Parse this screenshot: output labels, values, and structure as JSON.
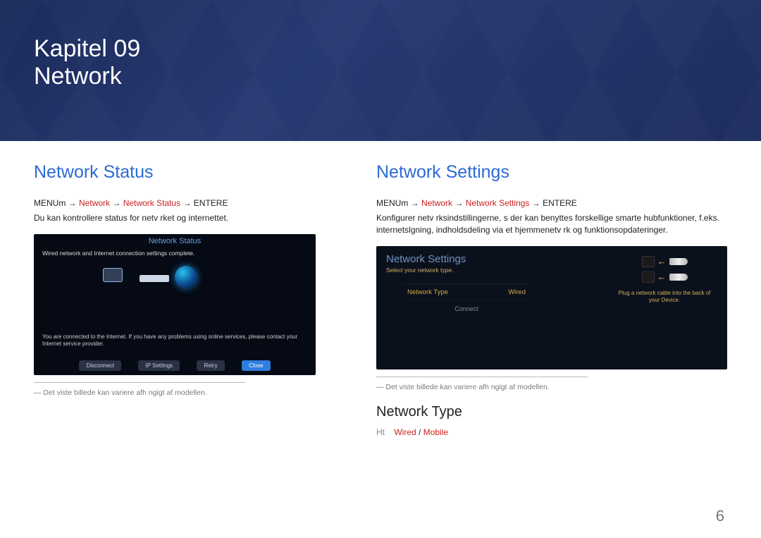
{
  "page_number": "6",
  "header": {
    "chapter_line": "Kapitel 09",
    "title_line": "Network"
  },
  "left": {
    "heading": "Network Status",
    "path": {
      "prefix": "MENUm",
      "sep": "→",
      "p1": "Network",
      "p2": "Network Status",
      "suffix": "ENTERE"
    },
    "body": "Du kan kontrollere status for netv rket og internettet.",
    "shot": {
      "title": "Network Status",
      "sub": "Wired network and Internet connection settings complete.",
      "msg": "You are connected to the Internet. If you have any problems using online services, please contact your Internet service provider.",
      "btn1": "Disconnect",
      "btn2": "IP Settings",
      "btn3": "Retry",
      "btn4": "Close"
    },
    "footnote": "― Det viste billede kan variere afh ngigt af modellen."
  },
  "right": {
    "heading": "Network Settings",
    "path": {
      "prefix": "MENUm",
      "sep": "→",
      "p1": "Network",
      "p2": "Network Settings",
      "suffix": "ENTERE"
    },
    "body": "Konfigurer netv rksindstillingerne, s  der kan benyttes forskellige smarte hubfunktioner, f.eks. internetslgning, indholdsdeling via et hjemmenetv rk og funktionsopdateringer.",
    "shot": {
      "title": "Network Settings",
      "sub": "Select your network type.",
      "item_label": "Network Type",
      "item_value": "Wired",
      "item2": "Connect",
      "hint": "Plug a network cable into the back of your Device."
    },
    "footnote": "― Det viste billede kan variere afh ngigt af modellen.",
    "subheading": "Network Type",
    "typeline": {
      "prefix": "Ht",
      "opt1": "Wired",
      "sep": "/",
      "opt2": "Mobile"
    }
  }
}
